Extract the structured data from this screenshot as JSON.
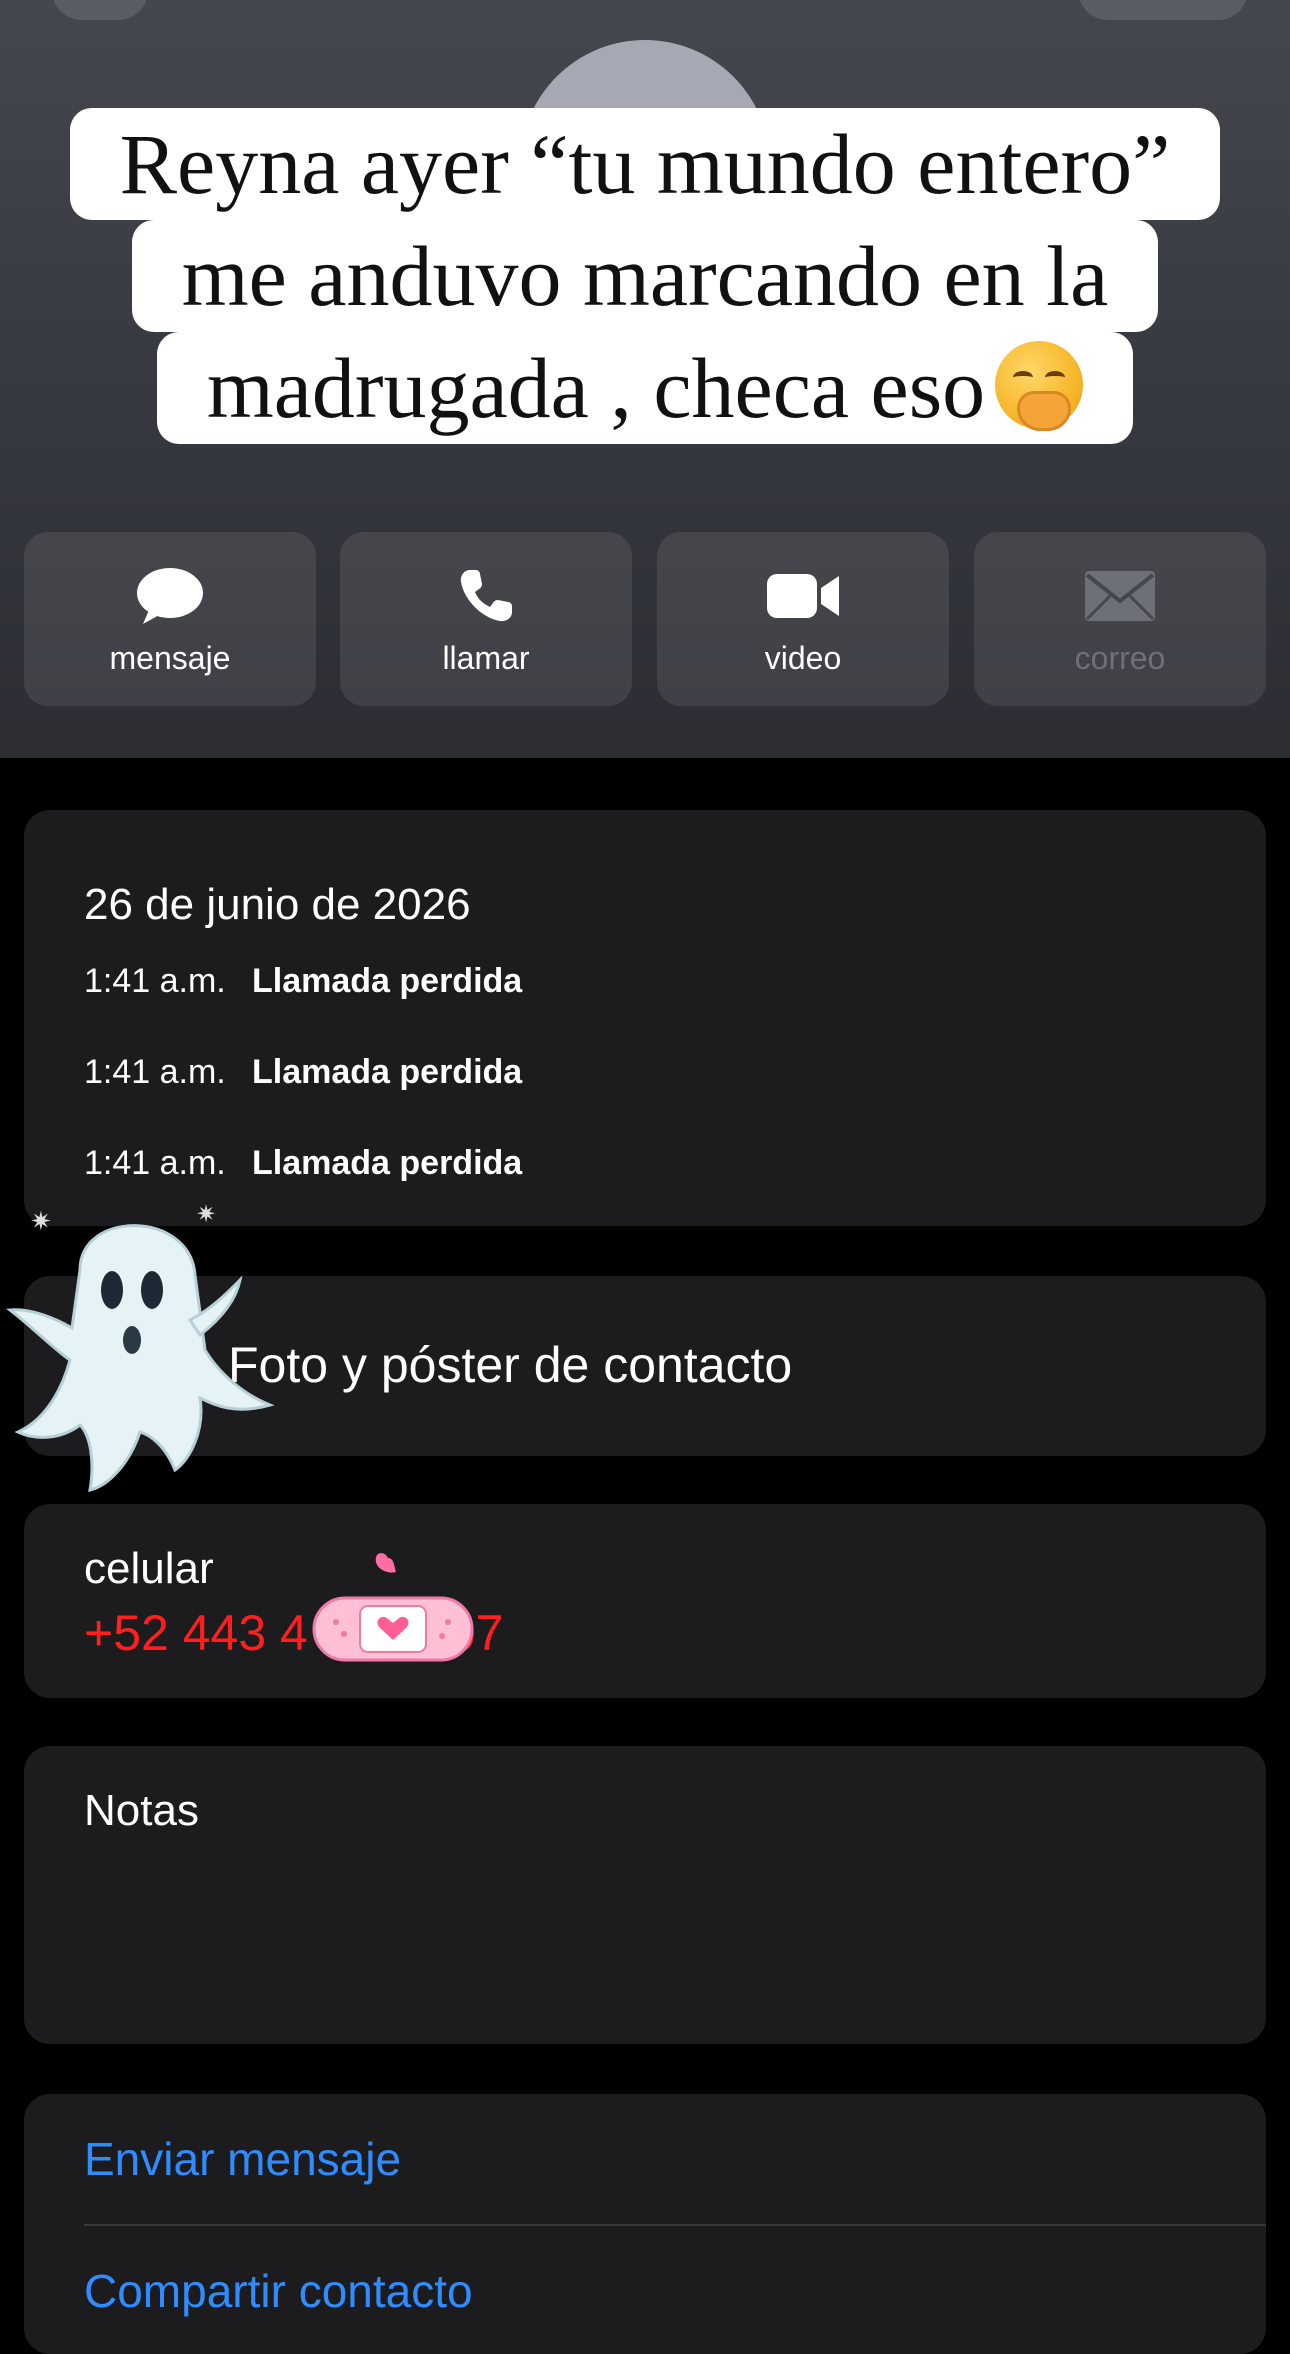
{
  "caption": {
    "line1": "Reyna ayer “tu mundo entero”",
    "line2": "me anduvo marcando en la",
    "line3": "madrugada , checa eso"
  },
  "actions": [
    {
      "label": "mensaje",
      "icon": "message-bubble-icon"
    },
    {
      "label": "llamar",
      "icon": "phone-icon"
    },
    {
      "label": "video",
      "icon": "video-camera-icon"
    },
    {
      "label": "correo",
      "icon": "mail-icon",
      "disabled": true
    }
  ],
  "calls": {
    "date": "26 de junio de 2026",
    "entries": [
      {
        "time": "1:41 a.m.",
        "status": "Llamada perdida"
      },
      {
        "time": "1:41 a.m.",
        "status": "Llamada perdida"
      },
      {
        "time": "1:41 a.m.",
        "status": "Llamada perdida"
      }
    ]
  },
  "poster": {
    "label": "Foto y póster de contacto"
  },
  "phone": {
    "label": "celular",
    "number_visible": "+52 443 4",
    "number_end": "07"
  },
  "notes": {
    "label": "Notas"
  },
  "links": {
    "send_message": "Enviar mensaje",
    "share_contact": "Compartir contacto"
  },
  "colors": {
    "accent": "#2f8cff",
    "phone_red": "#ff1f1f",
    "card_bg": "#1c1c1e"
  }
}
